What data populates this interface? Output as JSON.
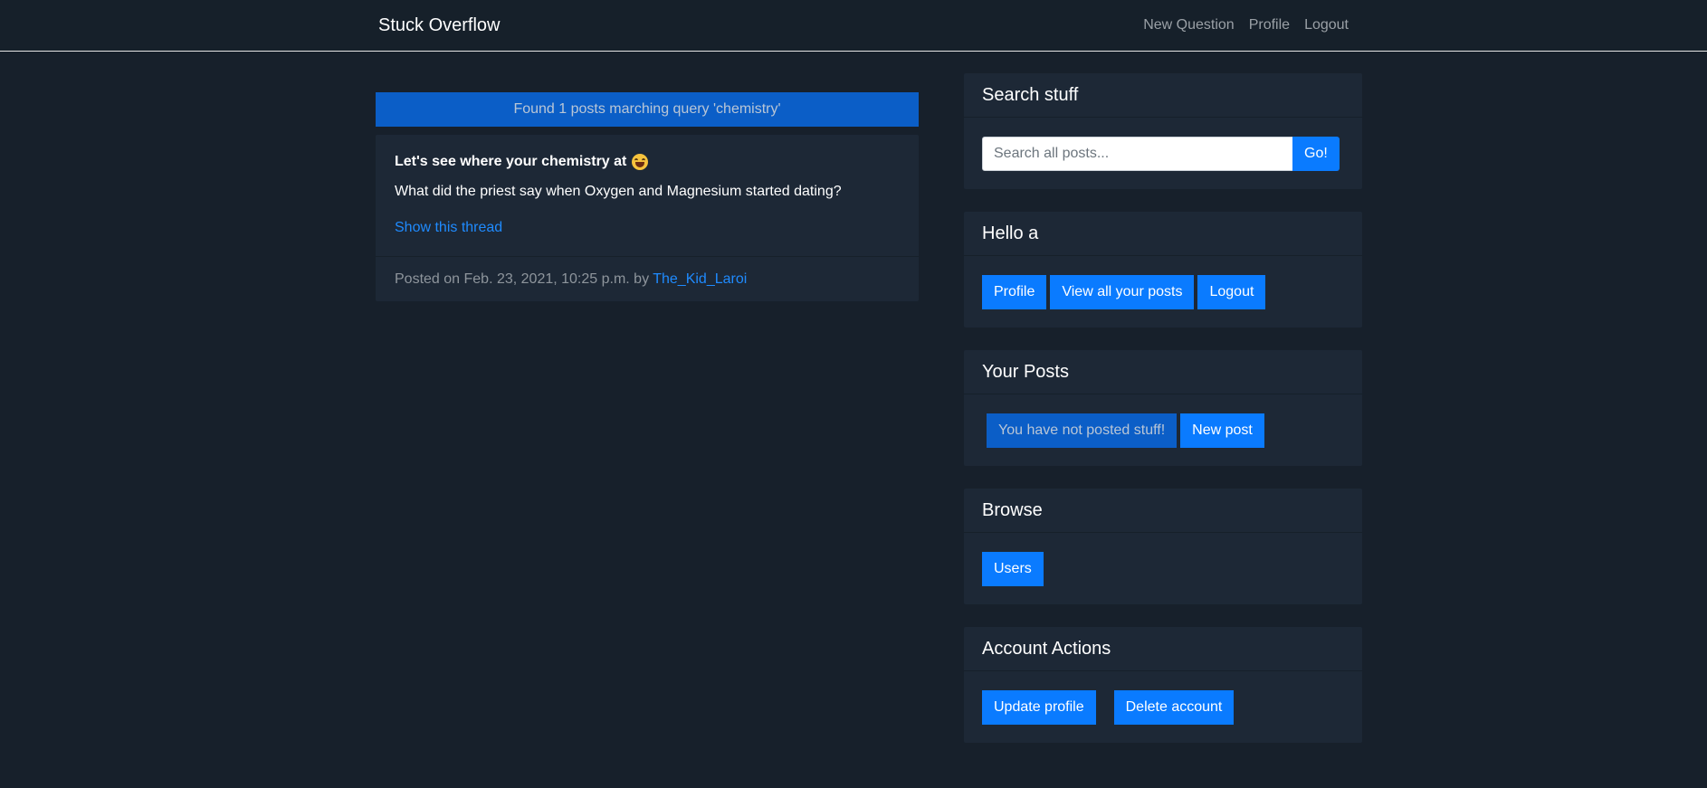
{
  "navbar": {
    "brand": "Stuck Overflow",
    "links": [
      "New Question",
      "Profile",
      "Logout"
    ]
  },
  "search_result": {
    "banner": "Found 1 posts marching query 'chemistry'",
    "post": {
      "title": "Let's see where your chemistry at",
      "title_emoji": "laughing-emoji-icon",
      "body": "What did the priest say when Oxygen and Magnesium started dating?",
      "link": "Show this thread",
      "footer_prefix": "Posted on Feb. 23, 2021, 10:25 p.m. by",
      "author": "The_Kid_Laroi"
    }
  },
  "sidebar": {
    "search": {
      "title": "Search stuff",
      "placeholder": "Search all posts...",
      "button": "Go!"
    },
    "hello": {
      "title": "Hello a",
      "buttons": [
        "Profile",
        "View all your posts",
        "Logout"
      ]
    },
    "your_posts": {
      "title": "Your Posts",
      "empty_text": "You have not posted stuff!",
      "new_button": "New post"
    },
    "browse": {
      "title": "Browse",
      "button": "Users"
    },
    "account": {
      "title": "Account Actions",
      "update_button": "Update profile",
      "delete_button": "Delete account"
    }
  },
  "colors": {
    "background": "#17202b",
    "card": "#1d2836",
    "primary": "#0a7bff",
    "link": "#1f8bff",
    "banner": "#0b5ec7"
  }
}
